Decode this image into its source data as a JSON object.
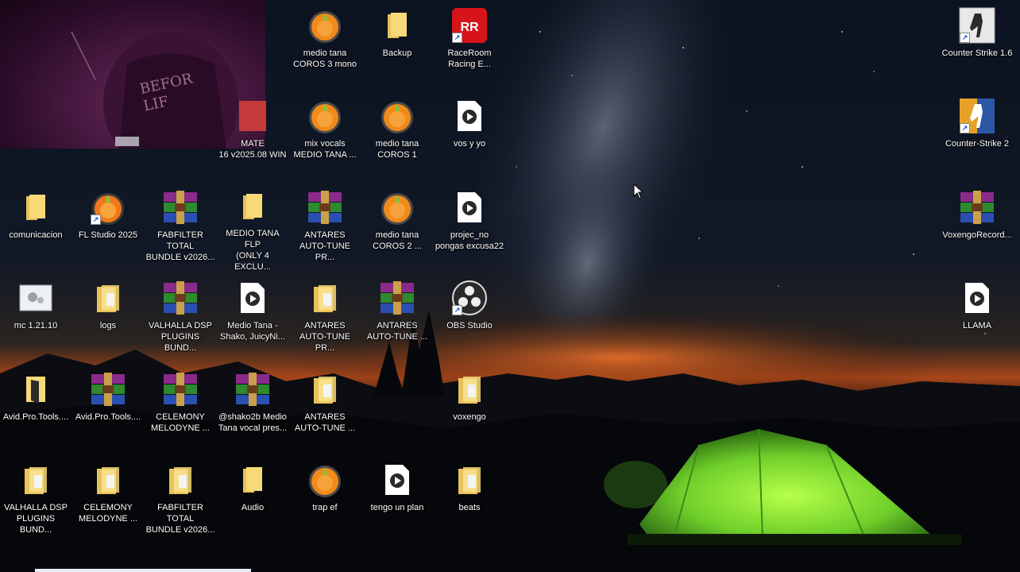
{
  "desktop": {
    "icons": [
      {
        "label": "medio tana\nCOROS 3 mono",
        "icon": "fl-studio-project-icon",
        "shortcut": false
      },
      {
        "label": "Backup",
        "icon": "folder-icon",
        "shortcut": false
      },
      {
        "label": "RaceRoom\nRacing E...",
        "icon": "raceroom-icon",
        "shortcut": true
      },
      {
        "label": "Counter Strike 1.6",
        "icon": "counter-strike-icon",
        "shortcut": true
      },
      {
        "label": "MATE\n16 v2025.08 WIN",
        "icon": "generic-app-icon",
        "shortcut": false
      },
      {
        "label": "mix vocals\nMEDIO TANA ...",
        "icon": "fl-studio-project-icon",
        "shortcut": false
      },
      {
        "label": "medio tana\nCOROS 1",
        "icon": "fl-studio-project-icon",
        "shortcut": false
      },
      {
        "label": "vos y yo",
        "icon": "media-file-icon",
        "shortcut": false
      },
      {
        "label": "Counter-Strike 2",
        "icon": "counter-strike-2-icon",
        "shortcut": true
      },
      {
        "label": "comunicacion",
        "icon": "folder-icon",
        "shortcut": false
      },
      {
        "label": "FL Studio 2025",
        "icon": "fl-studio-icon",
        "shortcut": true
      },
      {
        "label": "FABFILTER TOTAL\nBUNDLE v2026...",
        "icon": "winrar-archive-icon",
        "shortcut": false
      },
      {
        "label": "MEDIO TANA FLP\n(ONLY 4 EXCLU...",
        "icon": "folder-icon",
        "shortcut": false
      },
      {
        "label": "ANTARES\nAUTO-TUNE PR...",
        "icon": "winrar-archive-icon",
        "shortcut": false
      },
      {
        "label": "medio tana\nCOROS 2 ...",
        "icon": "fl-studio-project-icon",
        "shortcut": false
      },
      {
        "label": "projec_no\npongas excusa22",
        "icon": "media-file-icon",
        "shortcut": false
      },
      {
        "label": "VoxengoRecord...",
        "icon": "winrar-archive-icon",
        "shortcut": false
      },
      {
        "label": "mc 1.21.10",
        "icon": "settings-file-icon",
        "shortcut": false
      },
      {
        "label": "logs",
        "icon": "folder-docs-icon",
        "shortcut": false
      },
      {
        "label": "VALHALLA DSP\nPLUGINS BUND...",
        "icon": "winrar-archive-icon",
        "shortcut": false
      },
      {
        "label": "Medio Tana -\nShako, JuicyNi...",
        "icon": "media-file-icon",
        "shortcut": false
      },
      {
        "label": "ANTARES\nAUTO-TUNE PR...",
        "icon": "folder-docs-icon",
        "shortcut": false
      },
      {
        "label": "ANTARES\nAUTO-TUNE ...",
        "icon": "winrar-archive-icon",
        "shortcut": false
      },
      {
        "label": "OBS Studio",
        "icon": "obs-icon",
        "shortcut": true
      },
      {
        "label": "LLAMA",
        "icon": "media-file-icon",
        "shortcut": false
      },
      {
        "label": "Avid.Pro.Tools....",
        "icon": "folder-open-icon",
        "shortcut": false
      },
      {
        "label": "Avid.Pro.Tools....",
        "icon": "winrar-archive-icon",
        "shortcut": false
      },
      {
        "label": "CELEMONY\nMELODYNE ...",
        "icon": "winrar-archive-icon",
        "shortcut": false
      },
      {
        "label": "@shako2b Medio\nTana vocal pres...",
        "icon": "winrar-archive-icon",
        "shortcut": false
      },
      {
        "label": "ANTARES\nAUTO-TUNE ...",
        "icon": "folder-docs-icon",
        "shortcut": false
      },
      {
        "label": "voxengo",
        "icon": "folder-docs-icon",
        "shortcut": false
      },
      {
        "label": "VALHALLA DSP\nPLUGINS BUND...",
        "icon": "folder-docs-icon",
        "shortcut": false
      },
      {
        "label": "CELEMONY\nMELODYNE ...",
        "icon": "folder-docs-icon",
        "shortcut": false
      },
      {
        "label": "FABFILTER TOTAL\nBUNDLE v2026...",
        "icon": "folder-docs-icon",
        "shortcut": false
      },
      {
        "label": "Audio",
        "icon": "folder-icon",
        "shortcut": false
      },
      {
        "label": "trap ef",
        "icon": "fl-studio-project-icon",
        "shortcut": false
      },
      {
        "label": "tengo un plan",
        "icon": "media-file-icon",
        "shortcut": false
      },
      {
        "label": "beats",
        "icon": "folder-docs-icon",
        "shortcut": false
      }
    ]
  },
  "webcam": {
    "shirt_text": "BEFOR\nLIF"
  },
  "colors": {
    "tent": "#8be83a",
    "horizon": "#d9651e",
    "sky": "#0b1220"
  }
}
